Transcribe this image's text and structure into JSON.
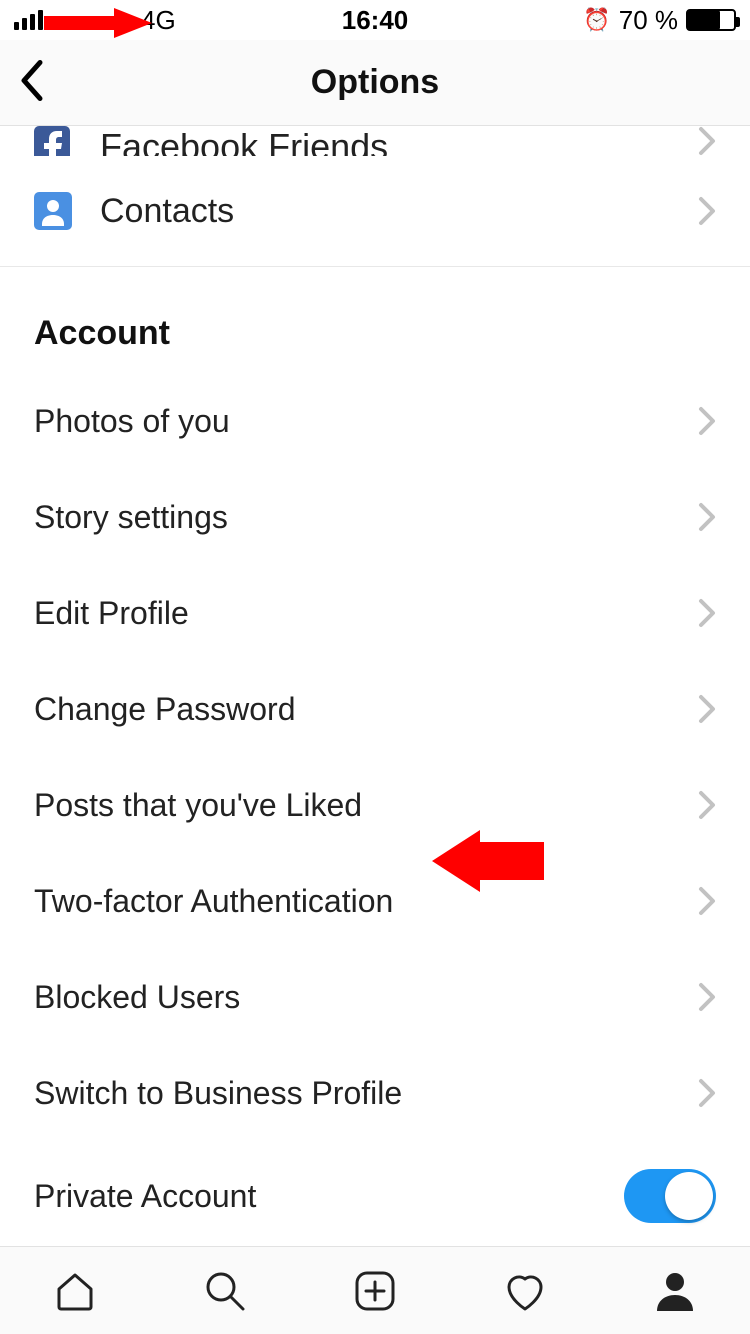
{
  "statusbar": {
    "network": "4G",
    "time": "16:40",
    "battery_text": "70 %",
    "battery_level_pct": 70
  },
  "header": {
    "title": "Options"
  },
  "partial_row": {
    "label": "Facebook Friends"
  },
  "contacts_row": {
    "label": "Contacts"
  },
  "section": {
    "title": "Account",
    "items": [
      {
        "label": "Photos of you"
      },
      {
        "label": "Story settings"
      },
      {
        "label": "Edit Profile"
      },
      {
        "label": "Change Password"
      },
      {
        "label": "Posts that you've Liked"
      },
      {
        "label": "Two-factor Authentication"
      },
      {
        "label": "Blocked Users"
      },
      {
        "label": "Switch to Business Profile"
      }
    ],
    "toggle_item": {
      "label": "Private Account",
      "on": true
    }
  },
  "colors": {
    "accent": "#1e97f3",
    "annotation": "#ff0000"
  }
}
